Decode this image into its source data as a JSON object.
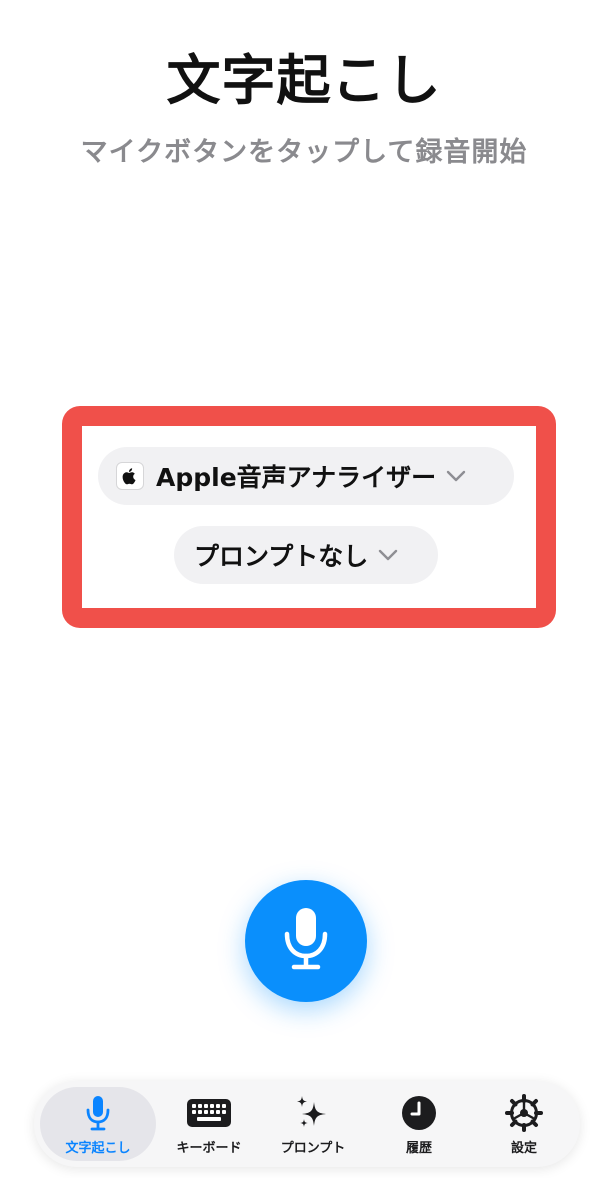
{
  "header": {
    "title": "文字起こし",
    "subtitle": "マイクボタンをタップして録音開始"
  },
  "options": {
    "model_label": "Apple音声アナライザー",
    "model_icon": "apple-logo-icon",
    "prompt_label": "プロンプトなし"
  },
  "record_button": {
    "icon": "microphone-icon",
    "color": "#0a8ffc"
  },
  "highlight": {
    "color": "#f0504a"
  },
  "tabbar": {
    "active_color": "#0a84ff",
    "tabs": [
      {
        "label": "文字起こし",
        "icon": "microphone-icon",
        "active": true
      },
      {
        "label": "キーボード",
        "icon": "keyboard-icon",
        "active": false
      },
      {
        "label": "プロンプト",
        "icon": "sparkles-icon",
        "active": false
      },
      {
        "label": "履歴",
        "icon": "clock-icon",
        "active": false
      },
      {
        "label": "設定",
        "icon": "gear-icon",
        "active": false
      }
    ]
  }
}
